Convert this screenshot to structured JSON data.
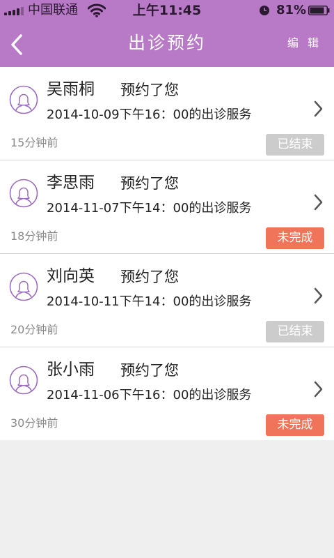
{
  "status_bar": {
    "carrier": "中国联通",
    "time": "上午11:45",
    "battery": "81%"
  },
  "nav": {
    "title": "出诊预约",
    "edit_label": "编 辑"
  },
  "colors": {
    "header": "#b87ac6",
    "accent": "#9b6bc2",
    "badge_done": "#cccccc",
    "badge_pending": "#f0745a"
  },
  "items": [
    {
      "name": "吴雨桐",
      "action": "预约了您",
      "service": "2014-10-09下午16：00的出诊服务",
      "time_ago": "15分钟前",
      "status": "已结束",
      "status_color": "#cccccc"
    },
    {
      "name": "李思雨",
      "action": "预约了您",
      "service": "2014-11-07下午14：00的出诊服务",
      "time_ago": "18分钟前",
      "status": "未完成",
      "status_color": "#f0745a"
    },
    {
      "name": "刘向英",
      "action": "预约了您",
      "service": "2014-10-11下午14：00的出诊服务",
      "time_ago": "20分钟前",
      "status": "已结束",
      "status_color": "#cccccc"
    },
    {
      "name": "张小雨",
      "action": "预约了您",
      "service": "2014-11-06下午16：00的出诊服务",
      "time_ago": "30分钟前",
      "status": "未完成",
      "status_color": "#f0745a"
    }
  ]
}
